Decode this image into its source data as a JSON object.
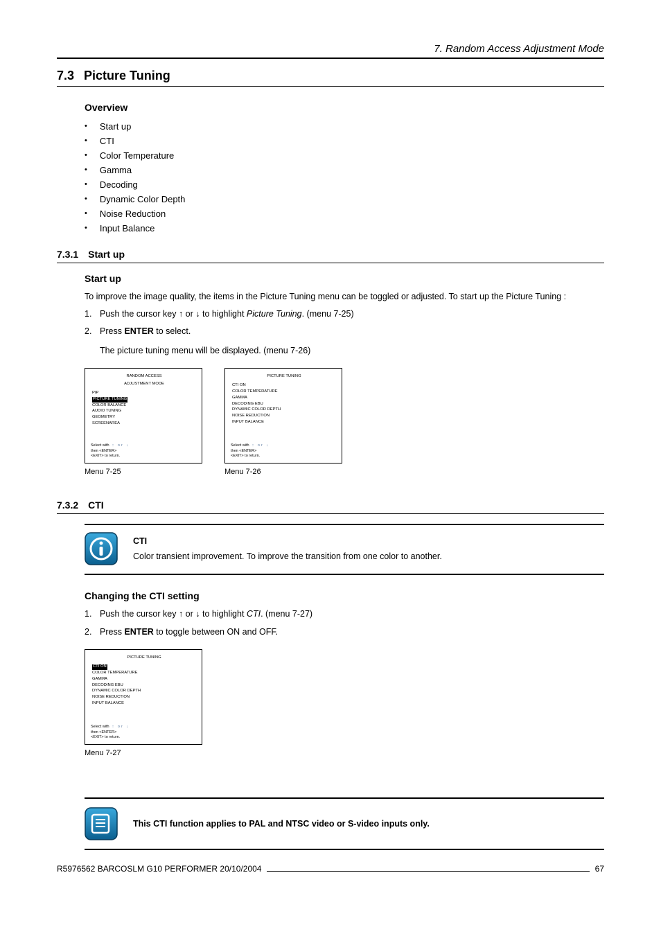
{
  "header": {
    "chapter": "7. Random Access Adjustment Mode"
  },
  "section": {
    "number": "7.3",
    "title": "Picture Tuning"
  },
  "overview": {
    "heading": "Overview",
    "items": [
      "Start up",
      "CTI",
      "Color Temperature",
      "Gamma",
      "Decoding",
      "Dynamic Color Depth",
      "Noise Reduction",
      "Input Balance"
    ]
  },
  "sub1": {
    "number": "7.3.1",
    "title": "Start up",
    "heading": "Start up",
    "intro": "To improve the image quality, the items in the Picture Tuning menu can be toggled or adjusted. To start up the Picture Tuning :",
    "step1_pre": "Push the cursor key ↑ or ↓ to highlight ",
    "step1_em": "Picture Tuning",
    "step1_post": ". (menu 7-25)",
    "step2_pre": "Press ",
    "step2_bold": "ENTER",
    "step2_post": " to select.",
    "step2_note": "The picture tuning menu will be displayed. (menu 7-26)"
  },
  "menu25": {
    "caption": "Menu 7-25",
    "title": "RANDOM ACCESS",
    "subtitle": "ADJUSTMENT MODE",
    "items_pre": [
      "PIP"
    ],
    "highlight": "PICTURE TUNING",
    "items_post": [
      "COLOR BALANCE",
      "AUDIO TUNING",
      "GEOMETRY",
      "SCREENAREA"
    ],
    "nav1": "Select with ↑ or ↓",
    "nav2": "then <ENTER>",
    "nav3": "<EXIT> to return."
  },
  "menu26": {
    "caption": "Menu 7-26",
    "title": "PICTURE TUNING",
    "items": [
      "CTI ON",
      "COLOR TEMPERATURE",
      "GAMMA",
      "DECODING EBU",
      "DYNAMIC COLOR DEPTH",
      "NOISE REDUCTION",
      "INPUT BALANCE"
    ],
    "nav1": "Select with ↑ or ↓",
    "nav2": "then <ENTER>",
    "nav3": "<EXIT> to return."
  },
  "sub2": {
    "number": "7.3.2",
    "title": "CTI",
    "info_title": "CTI",
    "info_text": "Color transient improvement. To improve the transition from one color to another.",
    "heading": "Changing the CTI setting",
    "step1_pre": "Push the cursor key ↑ or ↓ to highlight ",
    "step1_em": "CTI",
    "step1_post": ". (menu 7-27)",
    "step2_pre": "Press ",
    "step2_bold": "ENTER",
    "step2_post": " to toggle between ON and OFF."
  },
  "menu27": {
    "caption": "Menu 7-27",
    "title": "PICTURE TUNING",
    "highlight": "CTI ON",
    "items_post": [
      "COLOR TEMPERATURE",
      "GAMMA",
      "DECODING EBU",
      "DYNAMIC COLOR DEPTH",
      "NOISE REDUCTION",
      "INPUT BALANCE"
    ],
    "nav1": "Select with ↑ or ↓",
    "nav2": "then <ENTER>",
    "nav3": "<EXIT> to return."
  },
  "note": {
    "text": "This CTI function applies to PAL and NTSC video or S-video inputs only."
  },
  "footer": {
    "doc": "R5976562  BARCOSLM G10 PERFORMER  20/10/2004",
    "page": "67"
  },
  "labels": {
    "one": "1.",
    "two": "2."
  }
}
